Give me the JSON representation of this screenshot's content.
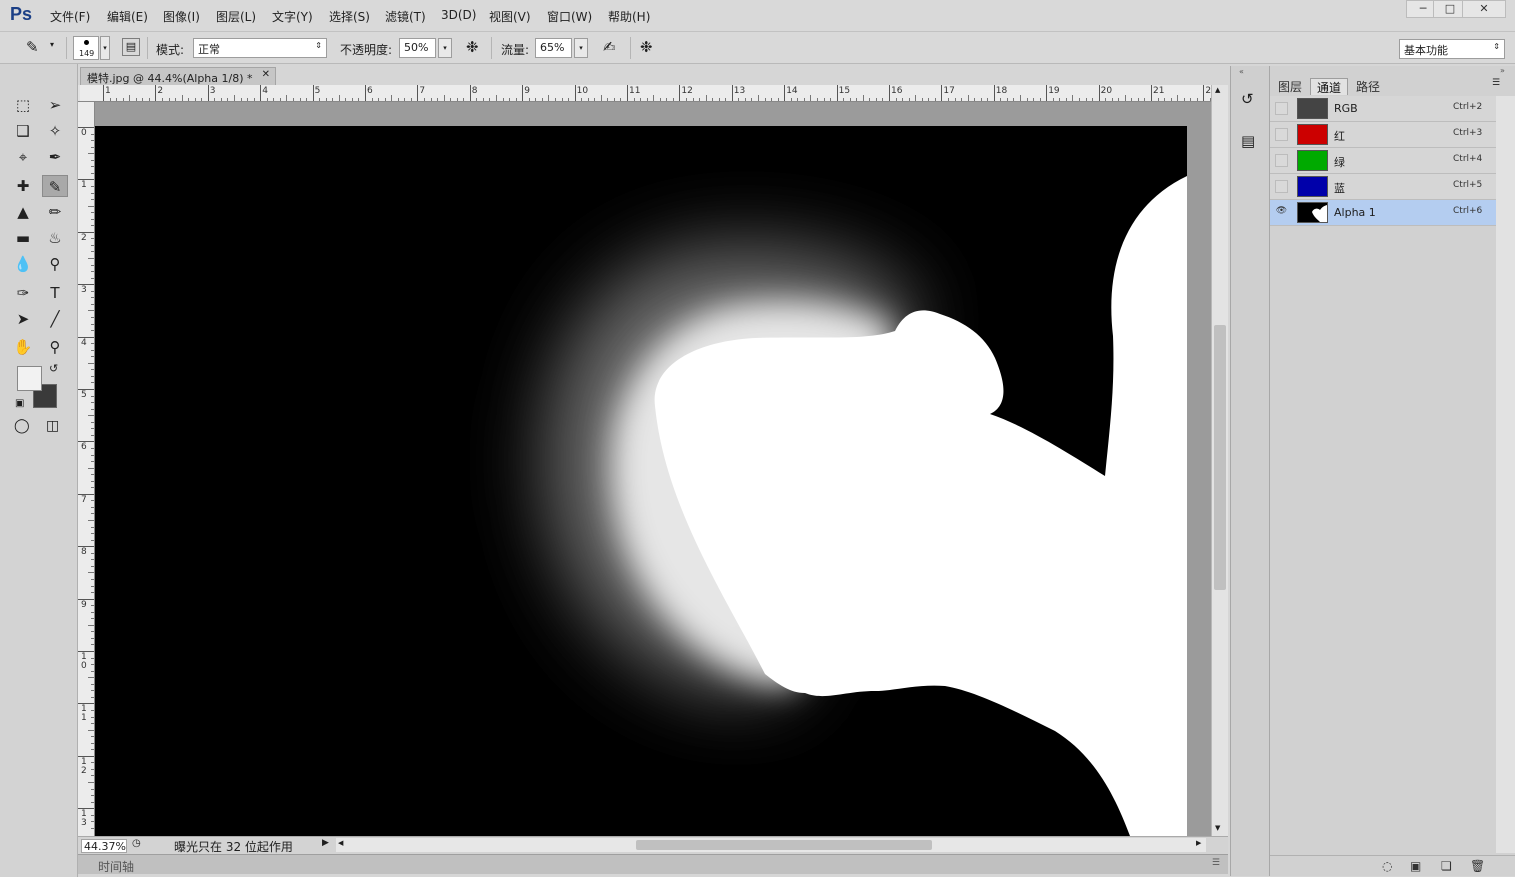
{
  "app": {
    "logo": "Ps",
    "menu": [
      "文件(F)",
      "编辑(E)",
      "图像(I)",
      "图层(L)",
      "文字(Y)",
      "选择(S)",
      "滤镜(T)",
      "3D(D)",
      "视图(V)",
      "窗口(W)",
      "帮助(H)"
    ],
    "window_controls": [
      "minimize-icon",
      "restore-icon",
      "close-icon"
    ]
  },
  "options": {
    "brush_size": "149",
    "mode_label": "模式:",
    "mode_value": "正常",
    "opacity_label": "不透明度:",
    "opacity_value": "50%",
    "flow_label": "流量:",
    "flow_value": "65%",
    "workspace": "基本功能"
  },
  "toolbox": {
    "tools": [
      "rectangular-marquee-icon",
      "move-icon",
      "lasso-icon",
      "quick-selection-icon",
      "crop-icon",
      "eyedropper-icon",
      "healing-brush-icon",
      "brush-icon",
      "clone-stamp-icon",
      "history-brush-icon",
      "eraser-icon",
      "paint-bucket-icon",
      "blur-icon",
      "dodge-icon",
      "pen-icon",
      "type-icon",
      "path-selection-icon",
      "line-icon",
      "hand-icon",
      "zoom-icon"
    ],
    "foreground_color": "#f2f2f2",
    "background_color": "#3a3a3a"
  },
  "document": {
    "tab_title": "模特.jpg @ 44.4%(Alpha 1/8) *",
    "ruler_h": [
      "1",
      "2",
      "3",
      "4",
      "5",
      "6",
      "7",
      "8",
      "9",
      "10",
      "11",
      "12",
      "13",
      "14",
      "15",
      "16",
      "17",
      "18",
      "19",
      "20",
      "21",
      "2"
    ],
    "ruler_v": [
      "0",
      "1",
      "2",
      "3",
      "4",
      "5",
      "6",
      "7",
      "8",
      "9",
      "10",
      "11",
      "12",
      "13"
    ],
    "zoom": "44.37%",
    "status_text": "曝光只在 32 位起作用",
    "timeline_label": "时间轴"
  },
  "channels_panel": {
    "tabs": [
      "图层",
      "通道",
      "路径"
    ],
    "active_tab": "通道",
    "channels": [
      {
        "name": "RGB",
        "shortcut": "Ctrl+2",
        "color": "#444444",
        "visible": false
      },
      {
        "name": "红",
        "shortcut": "Ctrl+3",
        "color": "#cc0000",
        "visible": false
      },
      {
        "name": "绿",
        "shortcut": "Ctrl+4",
        "color": "#00aa00",
        "visible": false
      },
      {
        "name": "蓝",
        "shortcut": "Ctrl+5",
        "color": "#0000aa",
        "visible": false
      },
      {
        "name": "Alpha 1",
        "shortcut": "Ctrl+6",
        "color": "#000000",
        "visible": true
      }
    ],
    "footer_icons": [
      "load-selection-icon",
      "save-selection-icon",
      "new-channel-icon",
      "delete-channel-icon"
    ]
  }
}
